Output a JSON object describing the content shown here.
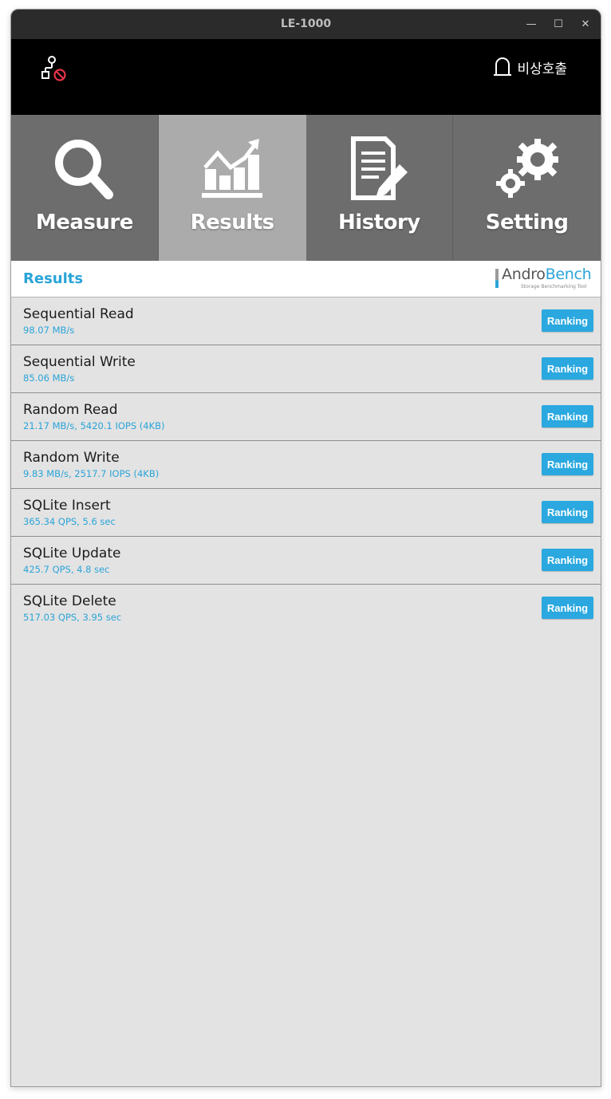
{
  "window": {
    "title": "LE-1000",
    "controls": {
      "minimize": "—",
      "maximize": "☐",
      "close": "✕"
    }
  },
  "topbar": {
    "network_icon": "network-disconnected-icon",
    "emergency_label": "비상호출",
    "emergency_icon": "bell-icon"
  },
  "tabs": [
    {
      "label": "Measure",
      "icon": "magnifier-icon",
      "active": false
    },
    {
      "label": "Results",
      "icon": "chart-icon",
      "active": true
    },
    {
      "label": "History",
      "icon": "document-pencil-icon",
      "active": false
    },
    {
      "label": "Setting",
      "icon": "gears-icon",
      "active": false
    }
  ],
  "section": {
    "title": "Results",
    "logo": {
      "andro": "Andro",
      "bench": "Bench",
      "tagline": "Storage Benchmarking Tool"
    }
  },
  "results": [
    {
      "name": "Sequential Read",
      "value": "98.07 MB/s",
      "button": "Ranking"
    },
    {
      "name": "Sequential Write",
      "value": "85.06 MB/s",
      "button": "Ranking"
    },
    {
      "name": "Random Read",
      "value": "21.17 MB/s, 5420.1 IOPS (4KB)",
      "button": "Ranking"
    },
    {
      "name": "Random Write",
      "value": "9.83 MB/s, 2517.7 IOPS (4KB)",
      "button": "Ranking"
    },
    {
      "name": "SQLite Insert",
      "value": "365.34 QPS, 5.6 sec",
      "button": "Ranking"
    },
    {
      "name": "SQLite Update",
      "value": "425.7 QPS, 4.8 sec",
      "button": "Ranking"
    },
    {
      "name": "SQLite Delete",
      "value": "517.03 QPS, 3.95 sec",
      "button": "Ranking"
    }
  ],
  "colors": {
    "accent": "#2aa4d8",
    "tab_bg": "#6d6d6d",
    "tab_active_bg": "#ababab",
    "topbar_bg": "#000000",
    "list_bg": "#e3e3e3",
    "alert": "#e8344a"
  }
}
